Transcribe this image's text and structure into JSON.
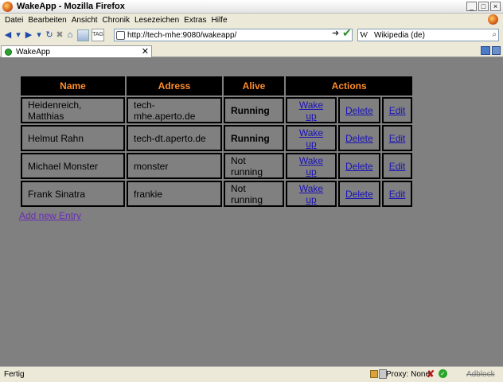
{
  "window": {
    "title": "WakeApp - Mozilla Firefox"
  },
  "menu": [
    "Datei",
    "Bearbeiten",
    "Ansicht",
    "Chronik",
    "Lesezeichen",
    "Extras",
    "Hilfe"
  ],
  "nav": {
    "url": "http://tech-mhe:9080/wakeapp/",
    "search_engine": "W",
    "search_value": "Wikipedia (de)",
    "tag_label": "TAG"
  },
  "tab": {
    "label": "WakeApp"
  },
  "table": {
    "headers": [
      "Name",
      "Adress",
      "Alive",
      "Actions"
    ],
    "rows": [
      {
        "name": "Heidenreich, Matthias",
        "address": "tech-mhe.aperto.de",
        "alive": "Running",
        "wake": "Wake up",
        "delete": "Delete",
        "edit": "Edit"
      },
      {
        "name": "Helmut Rahn",
        "address": "tech-dt.aperto.de",
        "alive": "Running",
        "wake": "Wake up",
        "delete": "Delete",
        "edit": "Edit"
      },
      {
        "name": "Michael Monster",
        "address": "monster",
        "alive": "Not running",
        "wake": "Wake up",
        "delete": "Delete",
        "edit": "Edit"
      },
      {
        "name": "Frank Sinatra",
        "address": "frankie",
        "alive": "Not running",
        "wake": "Wake up",
        "delete": "Delete",
        "edit": "Edit"
      }
    ]
  },
  "add_entry": "Add new Entry",
  "status": {
    "text": "Fertig",
    "proxy": "Proxy: None",
    "adblock": "Adblock"
  },
  "colors": {
    "content_bg": "#808080",
    "header_bg": "#000000",
    "header_text": "#ff8c2a",
    "link": "#1a12b8"
  }
}
